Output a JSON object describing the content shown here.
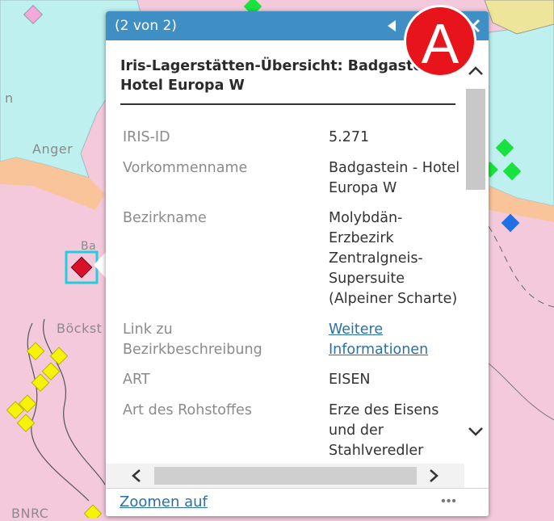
{
  "map": {
    "labels": {
      "anger": "Anger",
      "h": "n",
      "ba": "Ba",
      "boeckst": "Böckst",
      "bottom": "BNRC"
    },
    "colors": {
      "pink": "#f4c9dc",
      "cyan": "#bdf0ee",
      "orange": "#f9c49a",
      "yellow_region": "#ece59a",
      "marker_yellow": "#f7f20a",
      "marker_green": "#19e23e",
      "marker_blue": "#1f6fe8",
      "marker_red": "#d8102a",
      "selection": "#22cde0"
    }
  },
  "popup": {
    "header": {
      "counter": "(2 von 2)",
      "prev_icon": "triangle-left-icon",
      "close_icon": "close-icon"
    },
    "title": "Iris-Lagerstätten-Übersicht: Badgastein - Hotel Europa W",
    "fields": [
      {
        "label": "IRIS-ID",
        "value": "5.271"
      },
      {
        "label": "Vorkommenname",
        "value": "Badgastein - Hotel Europa W"
      },
      {
        "label": "Bezirkname",
        "value": "Molybdän-\nErzbezirk\nZentralgneis-\nSupersuite\n(Alpeiner Scharte)"
      },
      {
        "label": "Link zu Bezirkbeschreibung",
        "value": "Weitere Informationen"
      },
      {
        "label": "ART",
        "value": "EISEN"
      },
      {
        "label": "Art des Rohstoffes",
        "value": "Erze des Eisens\nund der\nStahlveredler"
      }
    ],
    "footer": {
      "zoom_label": "Zoomen auf",
      "more_label": "•••"
    },
    "accent": "#3f8fc4",
    "link_color": "#2a6fa8"
  },
  "badge": {
    "letter": "A",
    "color": "#e8141c"
  }
}
